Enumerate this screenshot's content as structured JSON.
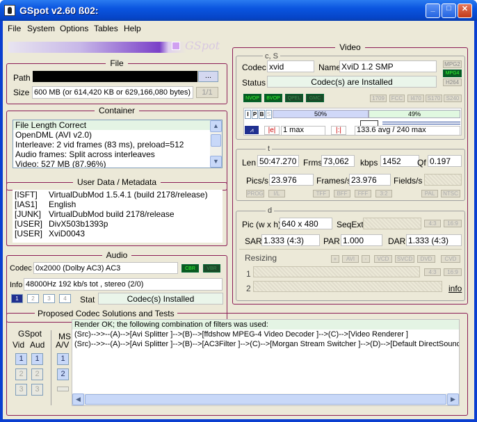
{
  "window": {
    "title": "GSpot v2.60 ß02:",
    "min": "_",
    "max": "□",
    "close": "✕"
  },
  "menu": [
    "File",
    "System",
    "Options",
    "Tables",
    "Help"
  ],
  "logo": "GSpot",
  "file": {
    "title": "File",
    "path_label": "Path",
    "path_value": "",
    "browse": "...",
    "size_label": "Size",
    "size_value": "600 MB (or 614,420 KB or 629,166,080 bytes)",
    "page": "1/1"
  },
  "container": {
    "title": "Container",
    "lines": [
      "File Length Correct",
      "OpenDML (AVI v2.0)",
      "Interleave: 2 vid frames (83 ms), preload=512",
      "Audio frames: Split across interleaves",
      "Video: 527 MB (87.96%)"
    ]
  },
  "userdata": {
    "title": "User Data / Metadata",
    "rows": [
      [
        "[ISFT]",
        "VirtualDubMod 1.5.4.1 (build 2178/release)"
      ],
      [
        "[IAS1]",
        "English"
      ],
      [
        "[JUNK]",
        "VirtualDubMod build 2178/release"
      ],
      [
        "[USER]",
        "DivX503b1393p"
      ],
      [
        "[USER]",
        "XviD0043"
      ]
    ]
  },
  "audio": {
    "title": "Audio",
    "codec_label": "Codec",
    "codec_value": "0x2000 (Dolby AC3) AC3",
    "cbr": "CBR",
    "vbr": "VBR",
    "info_label": "Info",
    "info_value": "48000Hz  192 kb/s tot , stereo (2/0)",
    "tabs": [
      "1",
      "2",
      "3",
      "4"
    ],
    "stat_label": "Stat",
    "stat_value": "Codec(s) Installed"
  },
  "video": {
    "title": "Video",
    "cs_title": "c, S",
    "codec_label": "Codec",
    "codec_value": "xvid",
    "name_label": "Name",
    "name_value": "XviD 1.2 SMP",
    "status_label": "Status",
    "status_value": "Codec(s) are Installed",
    "fmt": [
      "MPG2",
      "MPG4",
      "H264"
    ],
    "flags_on": [
      "NVOP",
      "BVOP",
      "QPEL",
      "GMC"
    ],
    "flags_off": [
      "1709",
      "FCC",
      "I470",
      "S170",
      "S240"
    ],
    "frame_types": [
      "I",
      "P",
      "B",
      "S"
    ],
    "pct1": "50%",
    "pct2": "49%",
    "bmax_a": "|e|",
    "bmax_b": "1 max",
    "avg": "133.6 avg / 240 max",
    "t_title": "t",
    "len_label": "Len",
    "len_value": "50:47.270",
    "frms_label": "Frms",
    "frms_value": "73,062",
    "kbps_label": "kbps",
    "kbps_value": "1452",
    "qf_label": "Qf",
    "qf_value": "0.197",
    "pics_label": "Pics/s",
    "pics_value": "23.976",
    "fps_label": "Frames/s",
    "fps_value": "23.976",
    "fields_label": "Fields/s",
    "fields_value": "",
    "tbtns": [
      "PROG",
      "I/L",
      "TFF",
      "BFF",
      "FFF",
      "3:2",
      "PAL",
      "NTSC"
    ],
    "d_title": "d",
    "pic_label": "Pic (w x h)",
    "pic_value": "640 x 480",
    "seqext_label": "SeqExt",
    "ar1": "4:3",
    "ar2": "16:9",
    "sar_label": "SAR",
    "sar_value": "1.333 (4:3)",
    "par_label": "PAR",
    "par_value": "1.000",
    "dar_label": "DAR",
    "dar_value": "1.333 (4:3)",
    "resizing_label": "Resizing",
    "rbtns": [
      "+",
      "AVI",
      "-",
      "VCD",
      "SVCD",
      "DVD",
      "CVD"
    ],
    "r1": "1",
    "r2": "2",
    "r_ar1": "4:3",
    "r_ar2": "16:9",
    "info_link": "info"
  },
  "codec_sol": {
    "title": "Proposed Codec Solutions and Tests",
    "gspot": "GSpot",
    "vid": "Vid",
    "aud": "Aud",
    "ms": "MS",
    "av": "A/V",
    "lines": [
      "Render OK; the following combination of filters was used:",
      "(Src)-->>--(A)-->[Avi Splitter ]-->(B)-->[ffdshow MPEG-4 Video Decoder ]-->(C)-->[Video Renderer ]",
      "(Src)-->>--(A)-->[Avi Splitter ]-->(B)-->[AC3Filter ]-->(C)-->[Morgan Stream Switcher ]-->(D)-->[Default DirectSound Device"
    ],
    "n1": "1",
    "n2": "2",
    "n3": "3"
  }
}
